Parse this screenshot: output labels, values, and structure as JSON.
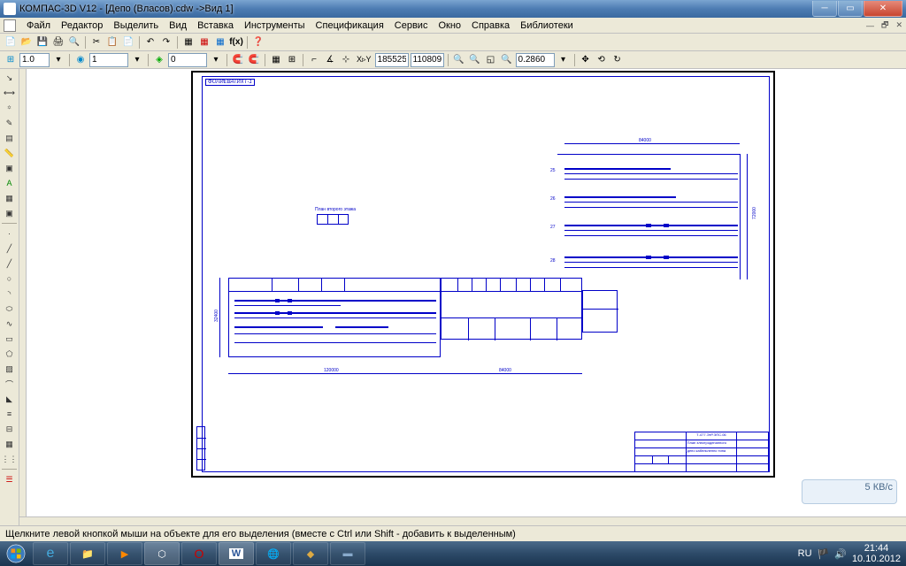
{
  "window": {
    "title": "КОМПАС-3D V12 - [Депо (Власов).cdw ->Вид 1]"
  },
  "menus": [
    "Файл",
    "Редактор",
    "Выделить",
    "Вид",
    "Вставка",
    "Инструменты",
    "Спецификация",
    "Сервис",
    "Окно",
    "Справка",
    "Библиотеки"
  ],
  "toolbar2": {
    "field1": "1.0",
    "field2": "1",
    "field3": "0",
    "coordX": "185525",
    "coordY": "110809",
    "zoom": "0.2860"
  },
  "drawing": {
    "label": "ФОЛИЕВАТИХТ-1",
    "caption1": "План второго этажа",
    "dim1": "84000",
    "dim2": "120000",
    "dim3": "84000",
    "dim4": "72000",
    "dim5": "32400",
    "titleblock": {
      "code": "Т-477.ЭтР.ЭПС.06",
      "desc1": "План электродепанного",
      "desc2": "депо кабельпенно типа"
    }
  },
  "statusbar": {
    "text": "Щелкните левой кнопкой мыши на объекте для его выделения (вместе с Ctrl или Shift - добавить к выделенным)"
  },
  "gadget": {
    "text": "5 КВ/с"
  },
  "systray": {
    "lang": "RU",
    "time": "21:44",
    "date": "10.10.2012"
  }
}
